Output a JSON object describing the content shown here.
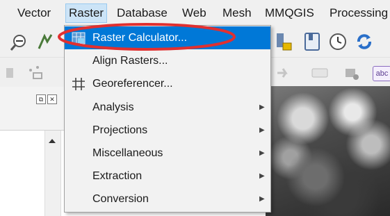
{
  "menubar": {
    "items": [
      "Vector",
      "Raster",
      "Database",
      "Web",
      "Mesh",
      "MMQGIS",
      "Processing"
    ],
    "active": "Raster"
  },
  "dock": {
    "float_label": "⧉",
    "close_label": "✕"
  },
  "raster_menu": {
    "items": [
      {
        "label": "Raster Calculator...",
        "icon": "calculator-icon",
        "submenu": false,
        "highlighted": true
      },
      {
        "label": "Align Rasters...",
        "icon": "",
        "submenu": false,
        "highlighted": false
      },
      {
        "label": "Georeferencer...",
        "icon": "georeferencer-icon",
        "submenu": false,
        "highlighted": false
      },
      {
        "label": "Analysis",
        "icon": "",
        "submenu": true,
        "highlighted": false
      },
      {
        "label": "Projections",
        "icon": "",
        "submenu": true,
        "highlighted": false
      },
      {
        "label": "Miscellaneous",
        "icon": "",
        "submenu": true,
        "highlighted": false
      },
      {
        "label": "Extraction",
        "icon": "",
        "submenu": true,
        "highlighted": false
      },
      {
        "label": "Conversion",
        "icon": "",
        "submenu": true,
        "highlighted": false
      }
    ],
    "highlight_color": "#0078d7",
    "annotation_color": "#e03030"
  },
  "toolbar": {
    "label_tag": "abc"
  }
}
